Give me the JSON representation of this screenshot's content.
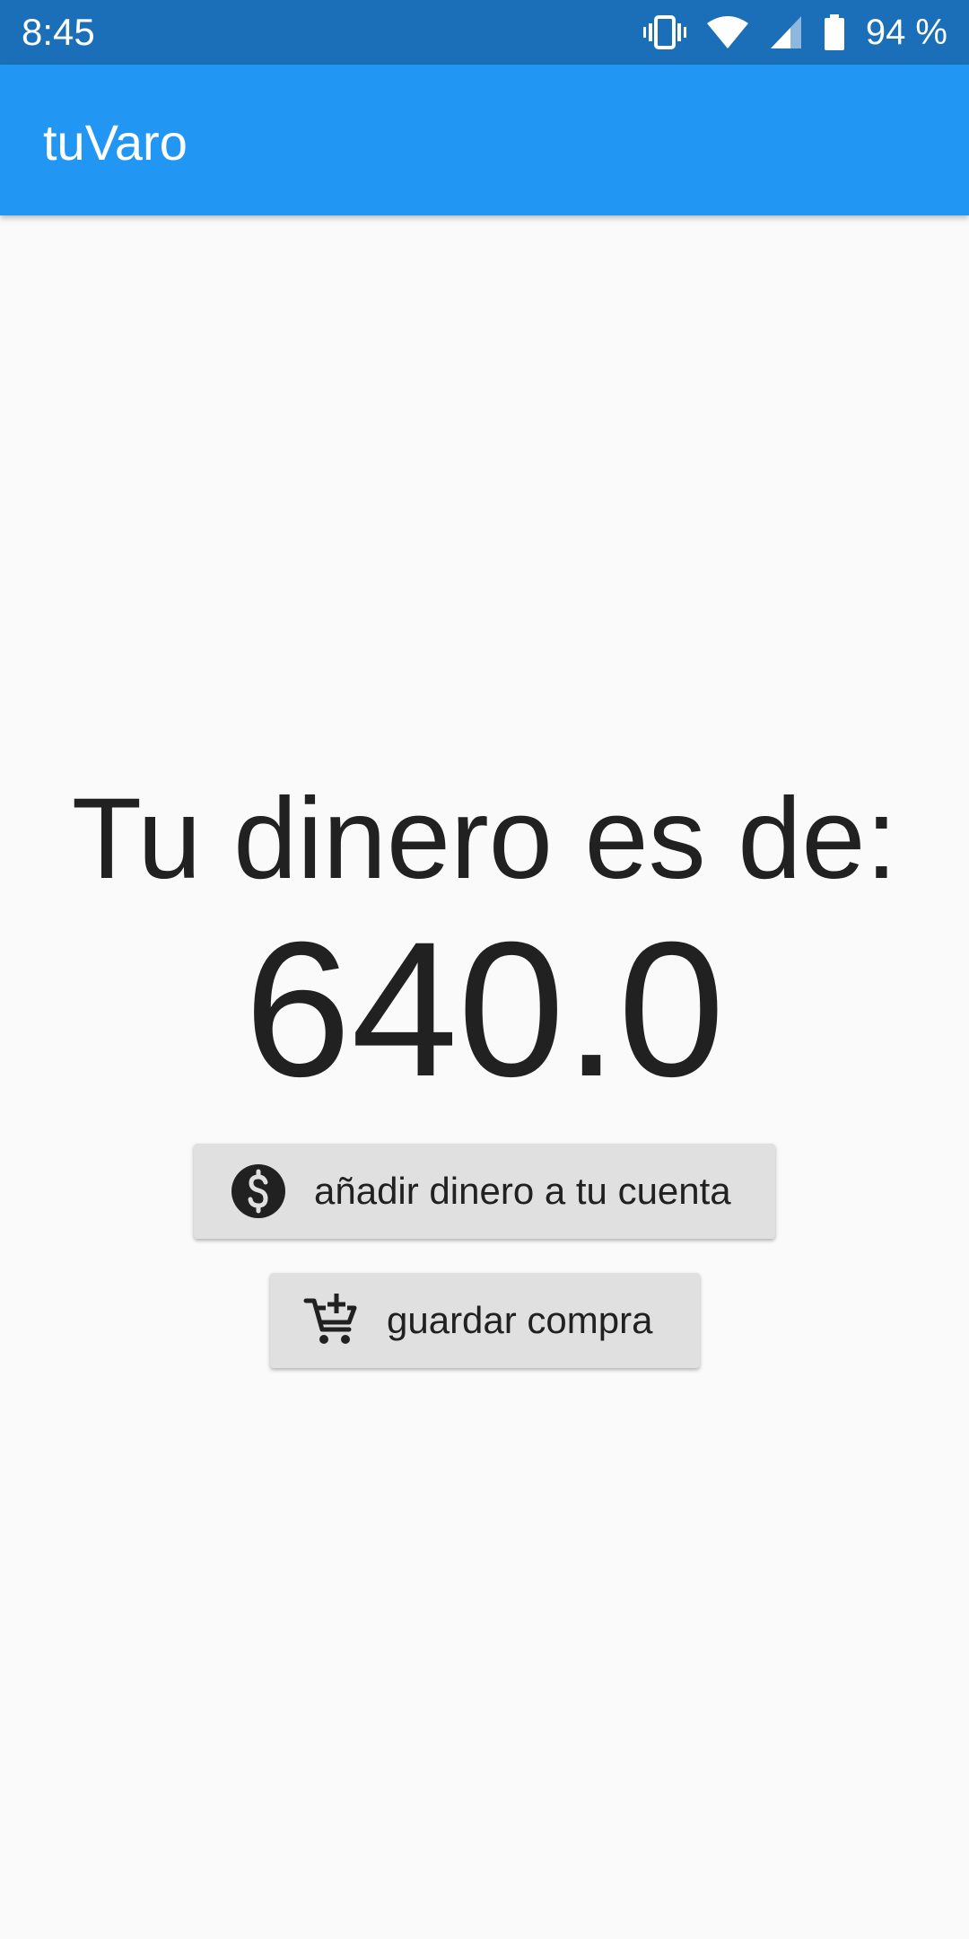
{
  "status_bar": {
    "time": "8:45",
    "battery_percent": "94 %",
    "icons": [
      "vibrate-icon",
      "wifi-icon",
      "cell-signal-icon",
      "battery-icon"
    ]
  },
  "app_bar": {
    "title": "tuVaro",
    "color": "#2196f3"
  },
  "main": {
    "headline": "Tu dinero es de:",
    "amount": "640.0",
    "buttons": {
      "add_money": {
        "label": "añadir dinero a tu cuenta",
        "icon": "dollar-circle-icon"
      },
      "save_purchase": {
        "label": "guardar compra",
        "icon": "add-shopping-cart-icon"
      }
    }
  }
}
